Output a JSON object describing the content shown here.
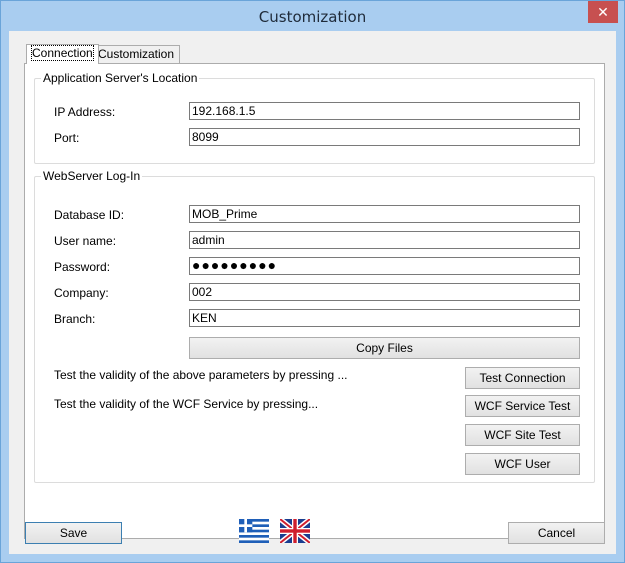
{
  "window": {
    "title": "Customization",
    "close_glyph": "✕"
  },
  "tabs": [
    {
      "label": "Connection"
    },
    {
      "label": "Customization"
    }
  ],
  "app_server_group": {
    "title": "Application Server's Location",
    "ip_label": "IP Address:",
    "ip_value": "192.168.1.5",
    "port_label": "Port:",
    "port_value": "8099"
  },
  "webserver_group": {
    "title": "WebServer Log-In",
    "database_label": "Database ID:",
    "database_value": "MOB_Prime",
    "username_label": "User name:",
    "username_value": "admin",
    "password_label": "Password:",
    "password_value": "●●●●●●●●●",
    "company_label": "Company:",
    "company_value": "002",
    "branch_label": "Branch:",
    "branch_value": "KEN",
    "copy_files_label": "Copy Files",
    "test_params_text": "Test the validity of the above parameters by pressing ...",
    "test_connection_label": "Test Connection",
    "test_wcf_text": "Test the validity of the WCF Service by pressing...",
    "wcf_service_test_label": "WCF Service Test",
    "wcf_site_test_label": "WCF Site Test",
    "wcf_user_label": "WCF User"
  },
  "footer": {
    "save_label": "Save",
    "cancel_label": "Cancel",
    "flags": [
      {
        "icon": "greek-flag-icon"
      },
      {
        "icon": "uk-flag-icon"
      }
    ]
  },
  "colors": {
    "titlebar": "#a9cdf0",
    "close_button": "#c75050",
    "primary_border": "#3c7fb1"
  }
}
